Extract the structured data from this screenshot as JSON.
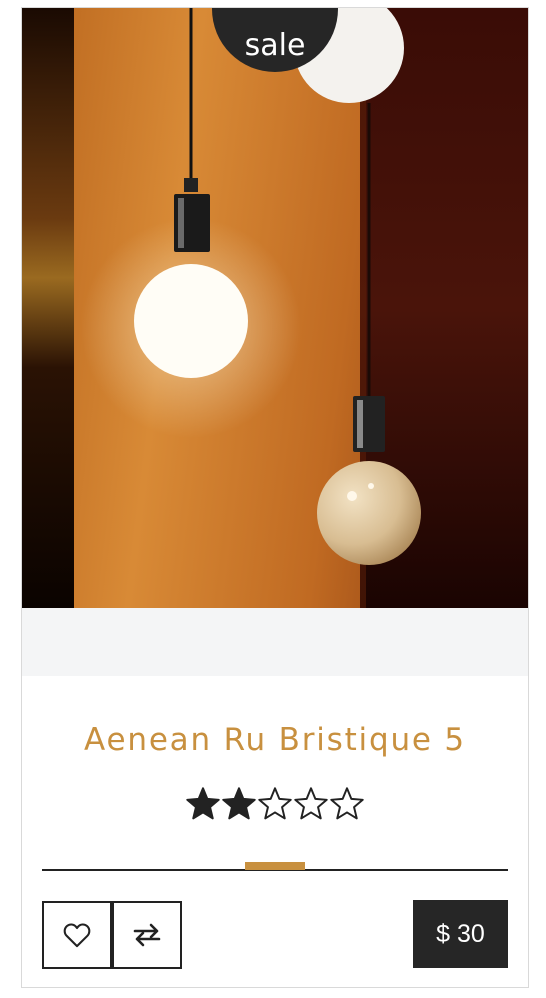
{
  "product": {
    "badge": "sale",
    "name": "Aenean Ru Bristique 5",
    "rating": {
      "value": 2,
      "max": 5
    },
    "price": "$ 30"
  },
  "icons": {
    "wishlist": "heart-icon",
    "compare": "compare-arrows-icon",
    "star_filled": "star-filled-icon",
    "star_empty": "star-outline-icon"
  },
  "colors": {
    "accent": "#c8903f",
    "dark": "#262626",
    "band": "#f4f5f6"
  }
}
